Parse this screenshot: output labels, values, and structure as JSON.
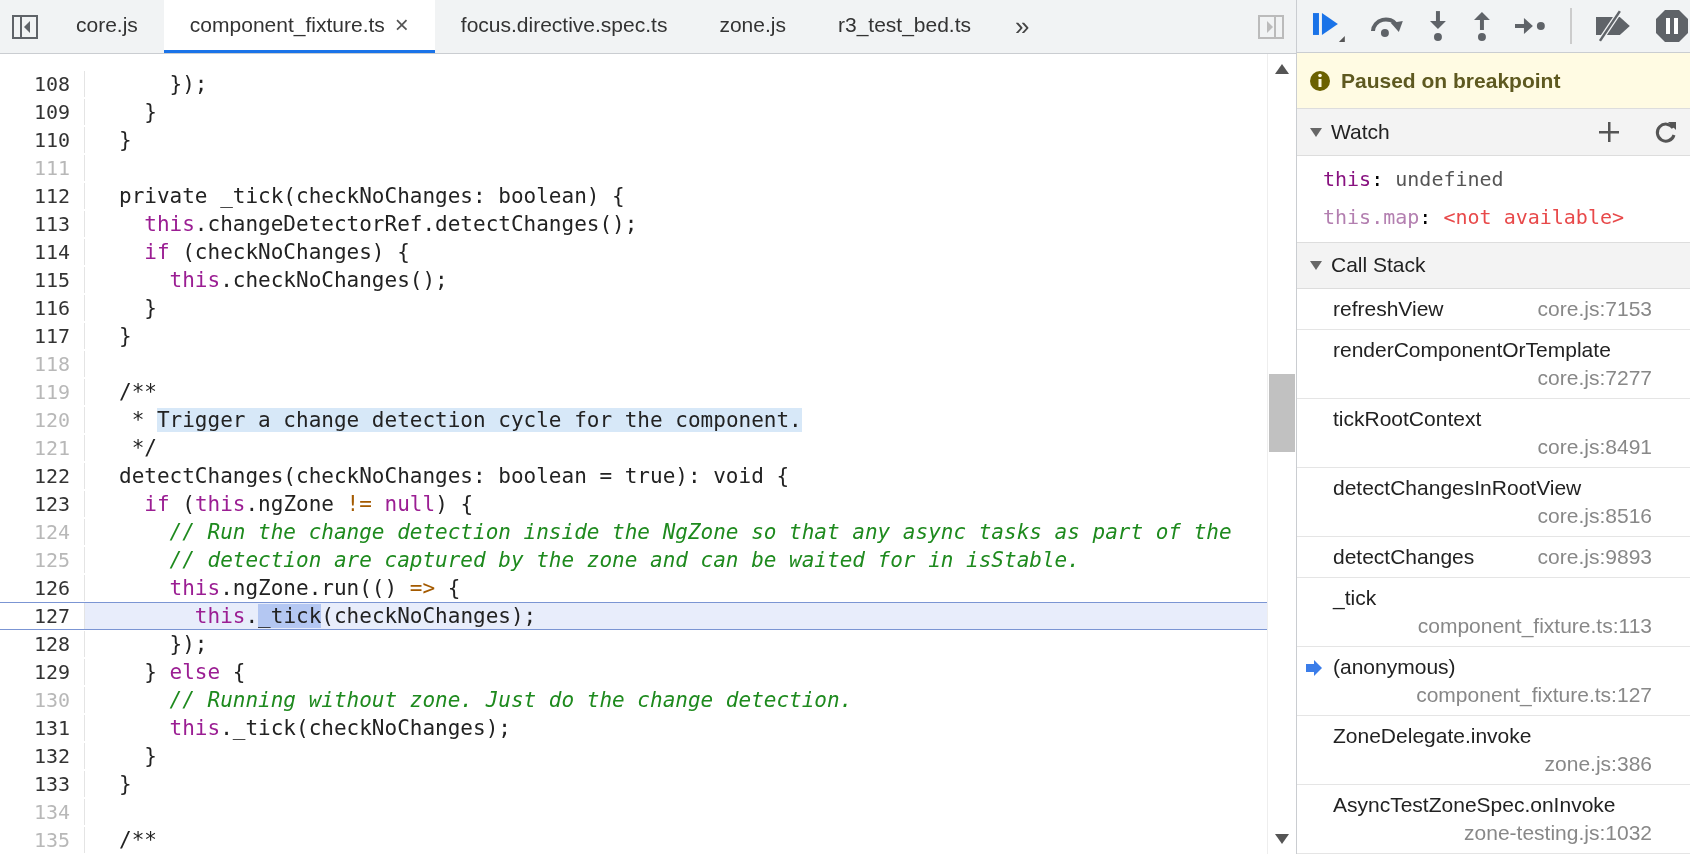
{
  "tabs": [
    {
      "label": "core.js",
      "selected": false
    },
    {
      "label": "component_fixture.ts",
      "selected": true,
      "close": "×"
    },
    {
      "label": "focus.directive.spec.ts",
      "selected": false
    },
    {
      "label": "zone.js",
      "selected": false
    },
    {
      "label": "r3_test_bed.ts",
      "selected": false
    }
  ],
  "more_tabs": "»",
  "editor": {
    "lines": [
      {
        "number": "108",
        "executable": true,
        "current": false,
        "tokens": [
          {
            "kind": "plain",
            "text": "    });"
          }
        ]
      },
      {
        "number": "109",
        "executable": true,
        "current": false,
        "tokens": [
          {
            "kind": "plain",
            "text": "  }"
          }
        ]
      },
      {
        "number": "110",
        "executable": true,
        "current": false,
        "tokens": [
          {
            "kind": "plain",
            "text": "}"
          }
        ]
      },
      {
        "number": "111",
        "executable": false,
        "current": false
      },
      {
        "number": "112",
        "executable": true,
        "current": false,
        "tokens": [
          {
            "kind": "plain",
            "text": "private _tick(checkNoChanges: boolean) {"
          }
        ]
      },
      {
        "number": "113",
        "executable": true,
        "current": false,
        "tokens": [
          {
            "kind": "keyword",
            "text": "  this"
          },
          {
            "kind": "plain",
            "text": ".changeDetectorRef.detectChanges();"
          }
        ]
      },
      {
        "number": "114",
        "executable": true,
        "current": false,
        "tokens": [
          {
            "kind": "keyword",
            "text": "  if"
          },
          {
            "kind": "plain",
            "text": " (checkNoChanges) {"
          }
        ]
      },
      {
        "number": "115",
        "executable": true,
        "current": false,
        "tokens": [
          {
            "kind": "keyword",
            "text": "    this"
          },
          {
            "kind": "plain",
            "text": ".checkNoChanges();"
          }
        ]
      },
      {
        "number": "116",
        "executable": true,
        "current": false,
        "tokens": [
          {
            "kind": "plain",
            "text": "  }"
          }
        ]
      },
      {
        "number": "117",
        "executable": true,
        "current": false,
        "tokens": [
          {
            "kind": "plain",
            "text": "}"
          }
        ]
      },
      {
        "number": "118",
        "executable": false,
        "current": false
      },
      {
        "number": "119",
        "executable": false,
        "current": false,
        "tokens": [
          {
            "kind": "plain",
            "text": "/**"
          }
        ]
      },
      {
        "number": "120",
        "executable": false,
        "current": false,
        "tokens": [
          {
            "kind": "plain",
            "text": " * "
          },
          {
            "kind": "selected",
            "text": "Trigger a change detection cycle for the component."
          }
        ]
      },
      {
        "number": "121",
        "executable": false,
        "current": false,
        "tokens": [
          {
            "kind": "plain",
            "text": " */"
          }
        ]
      },
      {
        "number": "122",
        "executable": true,
        "current": false,
        "tokens": [
          {
            "kind": "plain",
            "text": "detectChanges(checkNoChanges: boolean = true): void {"
          }
        ]
      },
      {
        "number": "123",
        "executable": true,
        "current": false,
        "tokens": [
          {
            "kind": "keyword",
            "text": "  if"
          },
          {
            "kind": "plain",
            "text": " ("
          },
          {
            "kind": "keyword",
            "text": "this"
          },
          {
            "kind": "plain",
            "text": ".ngZone "
          },
          {
            "kind": "operator",
            "text": "!= "
          },
          {
            "kind": "keyword",
            "text": "null"
          },
          {
            "kind": "plain",
            "text": ") {"
          }
        ]
      },
      {
        "number": "124",
        "executable": false,
        "current": false,
        "tokens": [
          {
            "kind": "comment",
            "text": "    // Run the change detection inside the NgZone so that any async tasks as part of the"
          }
        ]
      },
      {
        "number": "125",
        "executable": false,
        "current": false,
        "tokens": [
          {
            "kind": "comment",
            "text": "    // detection are captured by the zone and can be waited for in isStable."
          }
        ]
      },
      {
        "number": "126",
        "executable": true,
        "current": false,
        "tokens": [
          {
            "kind": "keyword",
            "text": "    this"
          },
          {
            "kind": "plain",
            "text": ".ngZone.run(() "
          },
          {
            "kind": "operator",
            "text": "=>"
          },
          {
            "kind": "plain",
            "text": " {"
          }
        ]
      },
      {
        "number": "127",
        "executable": true,
        "current": true,
        "tokens": [
          {
            "kind": "keyword",
            "text": "      this"
          },
          {
            "kind": "plain",
            "text": "."
          },
          {
            "kind": "selected",
            "text": "_tick"
          },
          {
            "kind": "plain",
            "text": "(checkNoChanges);"
          }
        ]
      },
      {
        "number": "128",
        "executable": true,
        "current": false,
        "tokens": [
          {
            "kind": "plain",
            "text": "    });"
          }
        ]
      },
      {
        "number": "129",
        "executable": true,
        "current": false,
        "tokens": [
          {
            "kind": "plain",
            "text": "  } "
          },
          {
            "kind": "keyword",
            "text": "else"
          },
          {
            "kind": "plain",
            "text": " {"
          }
        ]
      },
      {
        "number": "130",
        "executable": false,
        "current": false,
        "tokens": [
          {
            "kind": "comment",
            "text": "    // Running without zone. Just do the change detection."
          }
        ]
      },
      {
        "number": "131",
        "executable": true,
        "current": false,
        "tokens": [
          {
            "kind": "keyword",
            "text": "    this"
          },
          {
            "kind": "plain",
            "text": "._tick(checkNoChanges);"
          }
        ]
      },
      {
        "number": "132",
        "executable": true,
        "current": false,
        "tokens": [
          {
            "kind": "plain",
            "text": "  }"
          }
        ]
      },
      {
        "number": "133",
        "executable": true,
        "current": false,
        "tokens": [
          {
            "kind": "plain",
            "text": "}"
          }
        ]
      },
      {
        "number": "134",
        "executable": false,
        "current": false
      },
      {
        "number": "135",
        "executable": false,
        "current": false,
        "tokens": [
          {
            "kind": "plain",
            "text": "/**"
          }
        ]
      }
    ]
  },
  "status": {
    "text": "Paused on breakpoint"
  },
  "watch": {
    "title": "Watch",
    "expanded": true,
    "items": [
      {
        "name": "this",
        "separator": ":",
        "value": "undefined",
        "available": true
      },
      {
        "name": "this.map",
        "separator": ":",
        "value": "<not available>",
        "available": false
      }
    ]
  },
  "call_stack": {
    "title": "Call Stack",
    "expanded": true,
    "frames": [
      {
        "function": "refreshView",
        "location": "core.js:7153",
        "current": false
      },
      {
        "function": "renderComponentOrTemplate",
        "location": "core.js:7277",
        "current": false
      },
      {
        "function": "tickRootContext",
        "location": "core.js:8491",
        "current": false
      },
      {
        "function": "detectChangesInRootView",
        "location": "core.js:8516",
        "current": false
      },
      {
        "function": "detectChanges",
        "location": "core.js:9893",
        "current": false
      },
      {
        "function": "_tick",
        "location": "component_fixture.ts:113",
        "current": false
      },
      {
        "function": "(anonymous)",
        "location": "component_fixture.ts:127",
        "current": true
      },
      {
        "function": "ZoneDelegate.invoke",
        "location": "zone.js:386",
        "current": false
      },
      {
        "function": "AsyncTestZoneSpec.onInvoke",
        "location": "zone-testing.js:1032",
        "current": false
      }
    ]
  }
}
